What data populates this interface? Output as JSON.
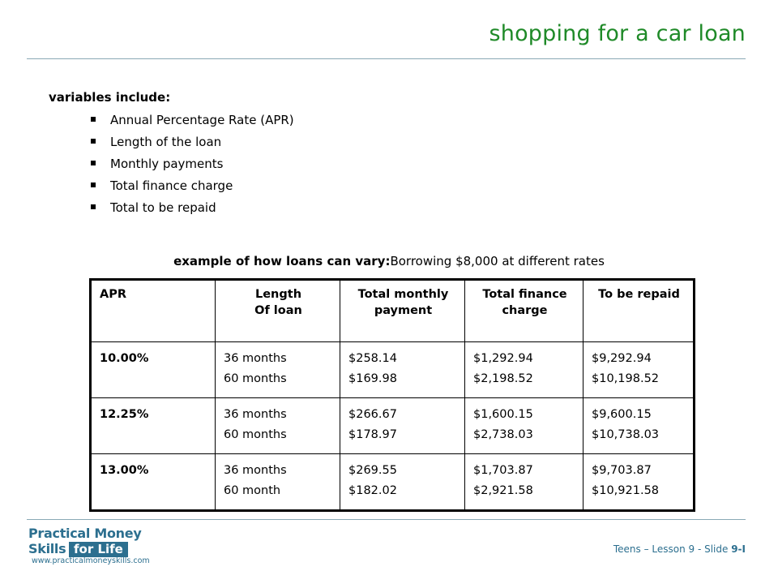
{
  "slide": {
    "title": "shopping for a car loan",
    "intro": "variables include:",
    "bullets": [
      "Annual Percentage Rate (APR)",
      "Length of the loan",
      "Monthly payments",
      "Total finance charge",
      "Total to be repaid"
    ],
    "caption_bold": "example of how loans can vary:",
    "caption_rest": "Borrowing $8,000 at different rates"
  },
  "table": {
    "headers": [
      [
        "APR"
      ],
      [
        "Length",
        "Of loan"
      ],
      [
        "Total monthly payment"
      ],
      [
        "Total finance charge"
      ],
      [
        "To be repaid"
      ]
    ],
    "rows": [
      {
        "apr": "10.00%",
        "length": [
          "36 months",
          "60 months"
        ],
        "monthly": [
          "$258.14",
          "$169.98"
        ],
        "finance": [
          "$1,292.94",
          "$2,198.52"
        ],
        "repaid": [
          "$9,292.94",
          "$10,198.52"
        ]
      },
      {
        "apr": "12.25%",
        "length": [
          "36 months",
          "60 months"
        ],
        "monthly": [
          "$266.67",
          "$178.97"
        ],
        "finance": [
          "$1,600.15",
          "$2,738.03"
        ],
        "repaid": [
          "$9,600.15",
          "$10,738.03"
        ]
      },
      {
        "apr": "13.00%",
        "length": [
          "36 months",
          "60 month"
        ],
        "monthly": [
          "$269.55",
          "$182.02"
        ],
        "finance": [
          "$1,703.87",
          "$2,921.58"
        ],
        "repaid": [
          "$9,703.87",
          "$10,921.58"
        ]
      }
    ]
  },
  "logo": {
    "line1": "Practical Money Skills",
    "line2": "for Life",
    "url": "www.practicalmoneyskills.com"
  },
  "footer": {
    "text": "Teens – Lesson 9 - Slide ",
    "slide_id": "9-I"
  },
  "colors": {
    "title": "#1f8a28",
    "rule": "#8aa9b6",
    "brand": "#2c6f8f"
  }
}
